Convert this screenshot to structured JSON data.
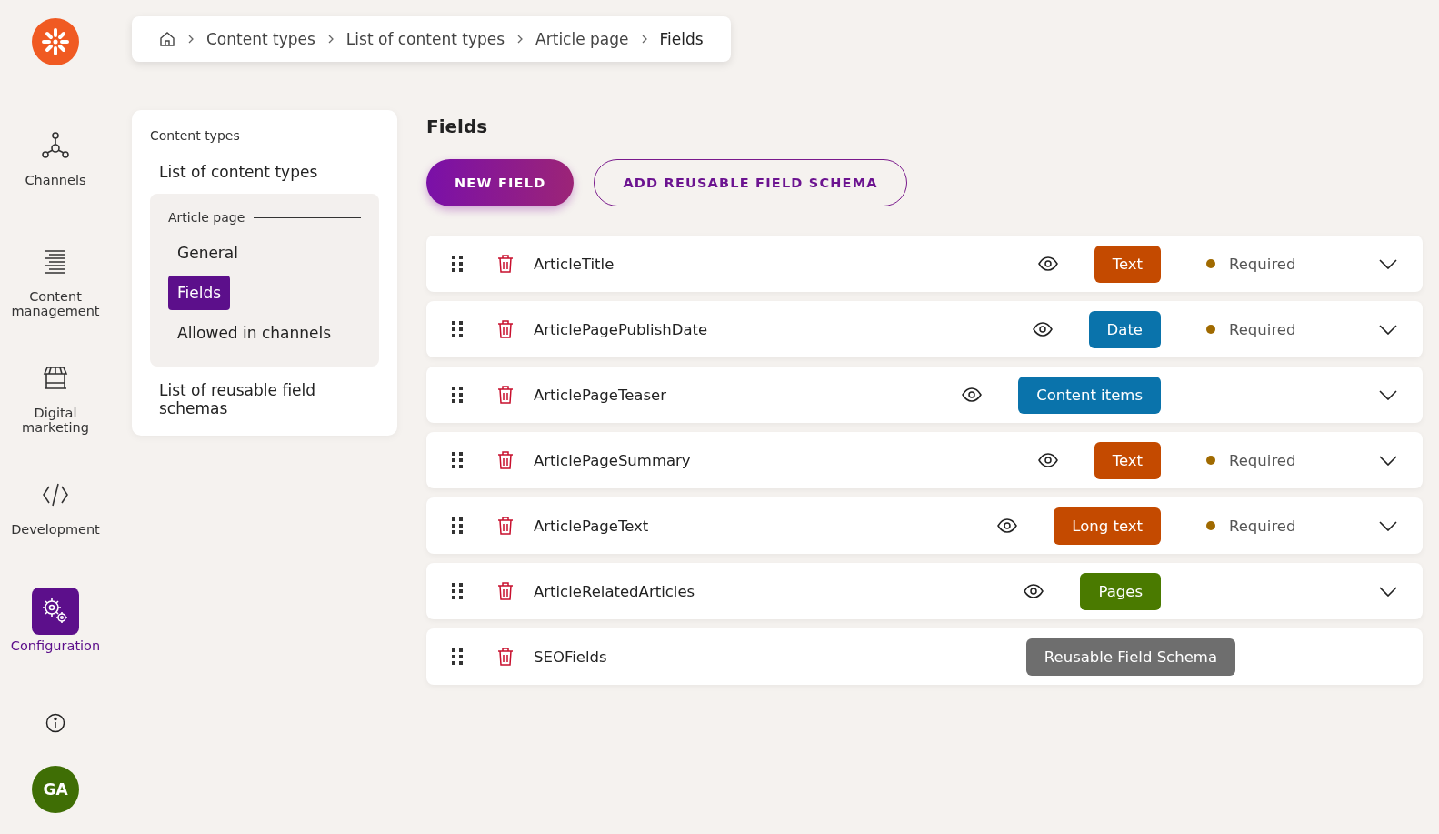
{
  "breadcrumb": [
    "Content types",
    "List of content types",
    "Article page",
    "Fields"
  ],
  "nav": [
    {
      "label": "Channels",
      "selected": false
    },
    {
      "label": "Content management",
      "selected": false
    },
    {
      "label": "Digital marketing",
      "selected": false
    },
    {
      "label": "Development",
      "selected": false
    },
    {
      "label": "Configuration",
      "selected": true
    }
  ],
  "avatar": "GA",
  "side_panel": {
    "title": "Content types",
    "link": "List of content types",
    "group": {
      "title": "Article page",
      "items": [
        {
          "label": "General",
          "selected": false
        },
        {
          "label": "Fields",
          "selected": true
        },
        {
          "label": "Allowed in channels",
          "selected": false
        }
      ]
    },
    "bottom_link": "List of reusable field schemas"
  },
  "page_title": "Fields",
  "buttons": [
    "NEW FIELD",
    "ADD REUSABLE FIELD SCHEMA"
  ],
  "fields": [
    {
      "kind": "field",
      "name": "ArticleTitle",
      "type": "Text",
      "color": "#c44a00",
      "required": true,
      "required_label": "Required"
    },
    {
      "kind": "field",
      "name": "ArticlePagePublishDate",
      "type": "Date",
      "color": "#0a73ab",
      "required": true,
      "required_label": "Required"
    },
    {
      "kind": "field",
      "name": "ArticlePageTeaser",
      "type": "Content items",
      "color": "#0a73ab",
      "required": false
    },
    {
      "kind": "field",
      "name": "ArticlePageSummary",
      "type": "Text",
      "color": "#c44a00",
      "required": true,
      "required_label": "Required"
    },
    {
      "kind": "field",
      "name": "ArticlePageText",
      "type": "Long text",
      "color": "#c44a00",
      "required": true,
      "required_label": "Required"
    },
    {
      "kind": "field",
      "name": "ArticleRelatedArticles",
      "type": "Pages",
      "color": "#4a7a00",
      "required": false
    },
    {
      "kind": "schema",
      "name": "SEOFields",
      "type": "Reusable Field Schema",
      "color": "#6e6e6e"
    }
  ]
}
